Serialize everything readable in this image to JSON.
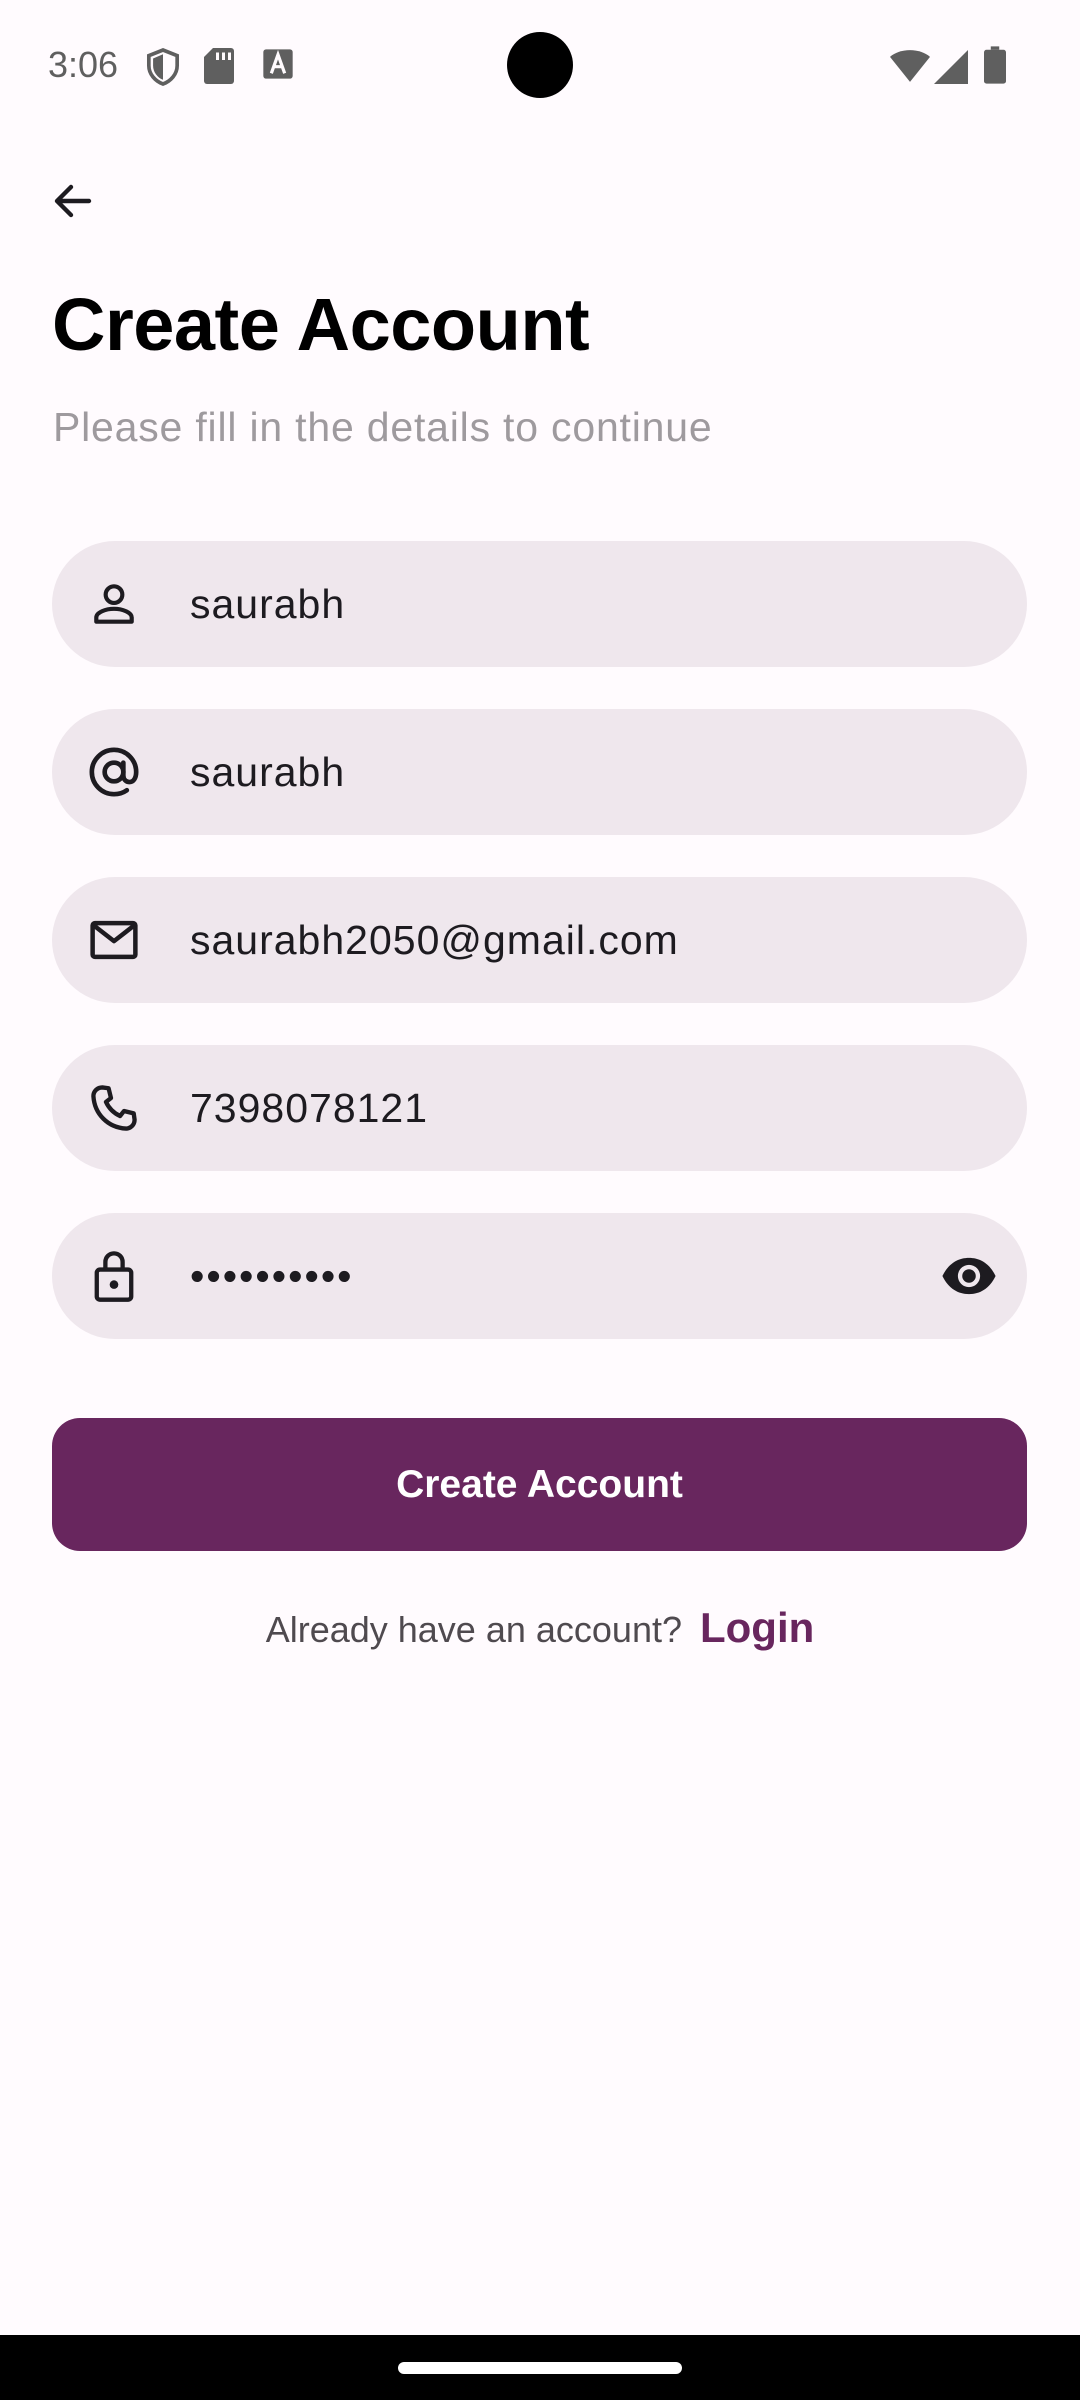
{
  "status_bar": {
    "time": "3:06",
    "icons": [
      "shield-icon",
      "sd-card-icon",
      "font-download-icon",
      "wifi-icon",
      "signal-icon",
      "battery-icon"
    ]
  },
  "header": {
    "back_icon": "arrow-back-icon",
    "title": "Create Account",
    "subtitle": "Please fill in the details to continue"
  },
  "form": {
    "name": {
      "icon": "person-icon",
      "value": "saurabh",
      "placeholder": ""
    },
    "username": {
      "icon": "at-sign-icon",
      "value": "saurabh",
      "placeholder": ""
    },
    "email": {
      "icon": "mail-icon",
      "value": "saurabh2050@gmail.com",
      "placeholder": ""
    },
    "phone": {
      "icon": "phone-icon",
      "value": "7398078121",
      "placeholder": ""
    },
    "password": {
      "icon": "lock-icon",
      "value": "••••••••••",
      "trailing_icon": "eye-icon",
      "placeholder": ""
    }
  },
  "actions": {
    "create_account_label": "Create Account",
    "login_prompt": "Already have an account?",
    "login_label": "Login"
  },
  "colors": {
    "primary": "#68265e",
    "field_bg": "#efe7ed",
    "background": "#fffbfe",
    "subtitle": "#9e9a9e"
  }
}
